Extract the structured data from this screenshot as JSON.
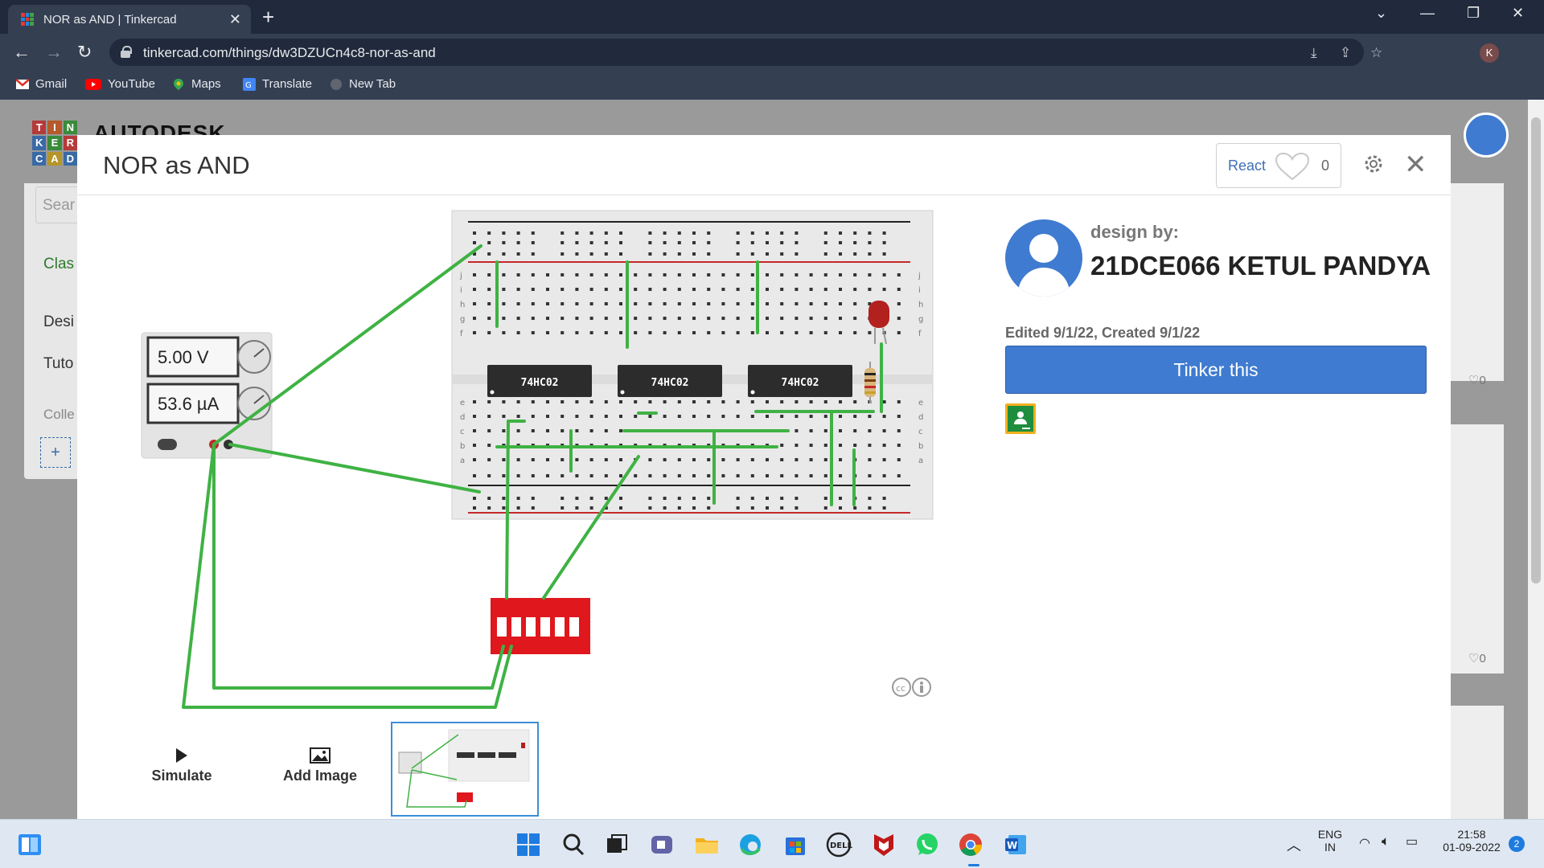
{
  "browser": {
    "tab_title": "NOR as AND | Tinkercad",
    "url": "tinkercad.com/things/dw3DZUCn4c8-nor-as-and",
    "profile_initial": "K",
    "bookmarks": [
      {
        "label": "Gmail",
        "icon": "gmail-icon"
      },
      {
        "label": "YouTube",
        "icon": "youtube-icon"
      },
      {
        "label": "Maps",
        "icon": "maps-icon"
      },
      {
        "label": "Translate",
        "icon": "translate-icon"
      },
      {
        "label": "New Tab",
        "icon": "globe-icon"
      }
    ]
  },
  "background_page": {
    "brand": "AUTODESK",
    "logo_letters": [
      "T",
      "I",
      "N",
      "K",
      "E",
      "R",
      "C",
      "A",
      "D"
    ],
    "sidebar_items": [
      "Sear",
      "Clas",
      "Desi",
      "Tuto",
      "Colle"
    ],
    "like_counts": [
      "0",
      "0"
    ]
  },
  "modal": {
    "title": "NOR as AND",
    "react_label": "React",
    "react_count": "0",
    "design_by_label": "design by:",
    "designer_name": "21DCE066 KETUL PANDYA",
    "edited_text": "Edited 9/1/22, Created 9/1/22",
    "tinker_button": "Tinker this",
    "simulate_label": "Simulate",
    "add_image_label": "Add Image"
  },
  "circuit": {
    "power_supply": {
      "voltage": "5.00 V",
      "current": "53.6 µA"
    },
    "chips": [
      "74HC02",
      "74HC02",
      "74HC02"
    ],
    "breadboard_rows": [
      "j",
      "i",
      "h",
      "g",
      "f",
      "e",
      "d",
      "c",
      "b",
      "a"
    ],
    "led_color": "#b3211e",
    "wire_color": "#3fb244",
    "dip_switch_color": "#e0171d"
  },
  "taskbar": {
    "language": "ENG",
    "region": "IN",
    "time": "21:58",
    "date": "01-09-2022",
    "notification_count": "2"
  },
  "colors": {
    "accent": "#3f7bd0",
    "tab_bg": "#343f52",
    "titlebar_bg": "#202a3c"
  }
}
